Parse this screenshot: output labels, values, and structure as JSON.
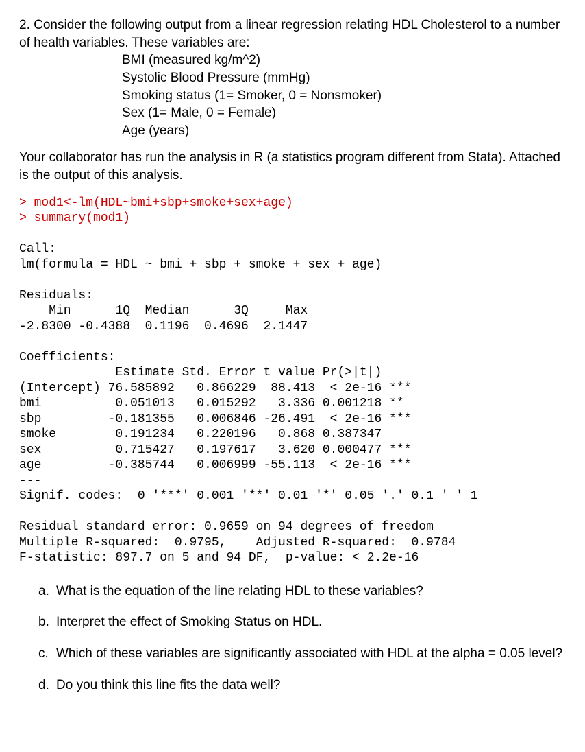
{
  "intro": {
    "lead": "2. Consider the following output from a linear regression relating HDL Cholesterol to a number of health variables. These variables are:",
    "vars": [
      "BMI (measured kg/m^2)",
      "Systolic Blood Pressure (mmHg)",
      "Smoking status (1= Smoker, 0 = Nonsmoker)",
      "Sex (1= Male, 0 = Female)",
      "Age (years)"
    ],
    "collab": "Your collaborator has run the analysis in R (a statistics program different from Stata). Attached is the output of this analysis."
  },
  "code": {
    "cmd1_prompt": "> ",
    "cmd1": "mod1<-lm(HDL~bmi+sbp+smoke+sex+age)",
    "cmd2_prompt": "> ",
    "cmd2": "summary(mod1)",
    "call_header": "Call:",
    "call_line": "lm(formula = HDL ~ bmi + sbp + smoke + sex + age)",
    "resid_header": "Residuals:",
    "resid_cols": "    Min      1Q  Median      3Q     Max ",
    "resid_vals": "-2.8300 -0.4388  0.1196  0.4696  2.1447 ",
    "coef_header": "Coefficients:",
    "coef_cols": "             Estimate Std. Error t value Pr(>|t|)    ",
    "coef_rows": [
      "(Intercept) 76.585892   0.866229  88.413  < 2e-16 ***",
      "bmi          0.051013   0.015292   3.336 0.001218 ** ",
      "sbp         -0.181355   0.006846 -26.491  < 2e-16 ***",
      "smoke        0.191234   0.220196   0.868 0.387347    ",
      "sex          0.715427   0.197617   3.620 0.000477 ***",
      "age         -0.385744   0.006999 -55.113  < 2e-16 ***"
    ],
    "dash": "---",
    "signif": "Signif. codes:  0 '***' 0.001 '**' 0.01 '*' 0.05 '.' 0.1 ' ' 1",
    "rse": "Residual standard error: 0.9659 on 94 degrees of freedom",
    "r2": "Multiple R-squared:  0.9795,\tAdjusted R-squared:  0.9784 ",
    "fstat": "F-statistic: 897.7 on 5 and 94 DF,  p-value: < 2.2e-16"
  },
  "questions": {
    "a": {
      "letter": "a.",
      "text": "What is the equation of the line relating HDL to these variables?"
    },
    "b": {
      "letter": "b.",
      "text": "Interpret the effect of Smoking Status on HDL."
    },
    "c": {
      "letter": "c.",
      "text": "Which of these variables are significantly associated with HDL at the alpha = 0.05 level?"
    },
    "d": {
      "letter": "d.",
      "text": "Do you think this line fits the data well?"
    }
  }
}
